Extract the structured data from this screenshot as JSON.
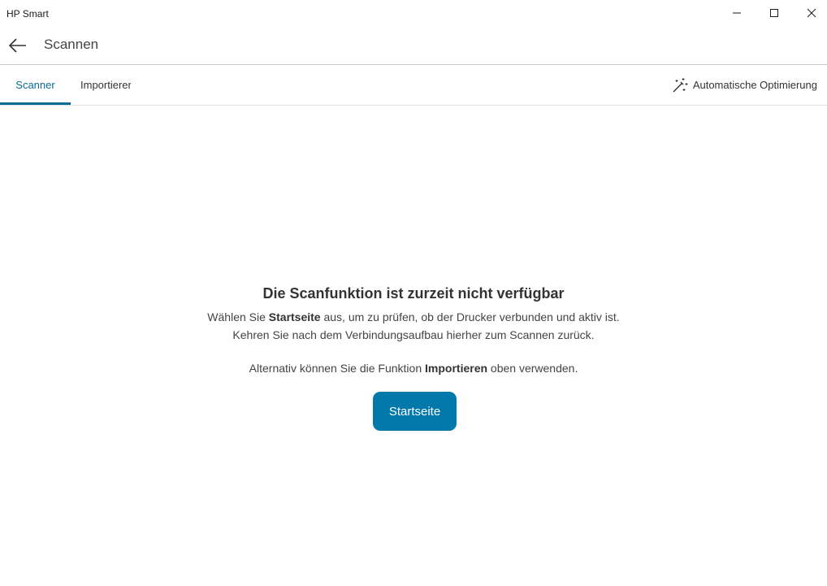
{
  "window": {
    "app_title": "HP Smart"
  },
  "header": {
    "title": "Scannen"
  },
  "tabs": [
    {
      "label": "Scanner",
      "active": true
    },
    {
      "label": "Importieren",
      "active": false
    }
  ],
  "toolbar": {
    "auto_optimization_label": "Automatische Optimierung"
  },
  "message": {
    "title": "Die Scanfunktion ist zurzeit nicht verfügbar",
    "line1_prefix": "Wählen Sie ",
    "line1_bold": "Startseite",
    "line1_suffix": " aus, um zu prüfen, ob der Drucker verbunden und aktiv ist.",
    "line2": "Kehren Sie nach dem Verbindungsaufbau hierher zum Scannen zurück.",
    "line3_prefix": "Alternativ können Sie die Funktion ",
    "line3_bold": "Importieren",
    "line3_suffix": " oben verwenden."
  },
  "actions": {
    "home_button_label": "Startseite"
  },
  "colors": {
    "accent": "#0a6b93",
    "button": "#0278ab"
  },
  "icons": {
    "back": "arrow-left-icon",
    "minimize": "minimize-icon",
    "maximize": "maximize-icon",
    "close": "close-icon",
    "auto_optimization": "magic-wand-icon"
  }
}
